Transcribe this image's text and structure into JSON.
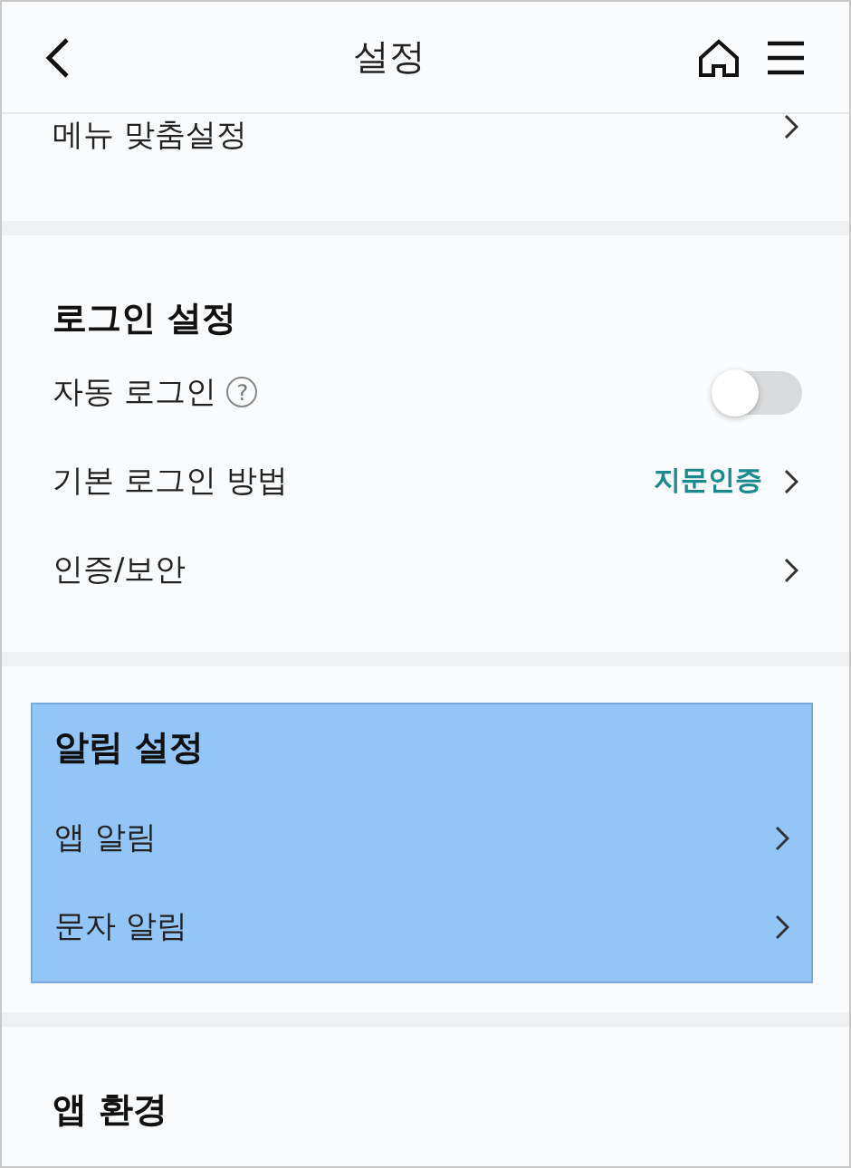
{
  "header": {
    "title": "설정"
  },
  "sections": [
    {
      "highlighted": false,
      "rows": [
        {
          "kind": "link",
          "label": "메뉴 맞춤설정"
        }
      ]
    },
    {
      "title": "로그인 설정",
      "highlighted": false,
      "rows": [
        {
          "kind": "toggle",
          "label": "자동 로그인",
          "help": "?",
          "on": false
        },
        {
          "kind": "link",
          "label": "기본 로그인 방법",
          "value": "지문인증"
        },
        {
          "kind": "link",
          "label": "인증/보안"
        }
      ]
    },
    {
      "title": "알림 설정",
      "highlighted": true,
      "rows": [
        {
          "kind": "link",
          "label": "앱 알림"
        },
        {
          "kind": "link",
          "label": "문자 알림"
        }
      ]
    },
    {
      "title": "앱 환경",
      "highlighted": false
    }
  ]
}
